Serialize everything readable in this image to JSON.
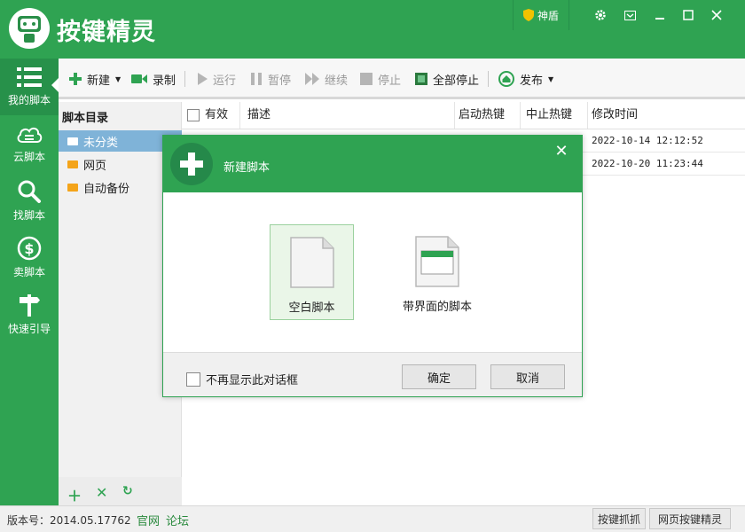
{
  "app": {
    "title": "按键精灵",
    "shield_label": "神盾"
  },
  "leftnav": [
    {
      "label": "我的脚本",
      "icon": "list-icon"
    },
    {
      "label": "云脚本",
      "icon": "cloud-icon"
    },
    {
      "label": "找脚本",
      "icon": "search-icon"
    },
    {
      "label": "卖脚本",
      "icon": "dollar-icon"
    },
    {
      "label": "快速引导",
      "icon": "signpost-icon"
    }
  ],
  "toolbar": {
    "new_label": "新建",
    "record_label": "录制",
    "run_label": "运行",
    "pause_label": "暂停",
    "resume_label": "继续",
    "stop_label": "停止",
    "stop_all_label": "全部停止",
    "publish_label": "发布"
  },
  "directory": {
    "title": "脚本目录",
    "items": [
      "未分类",
      "网页",
      "自动备份"
    ]
  },
  "table": {
    "columns": [
      "有效",
      "描述",
      "启动热键",
      "中止热键",
      "修改时间"
    ],
    "rows": [
      {
        "modified": "2022-10-14 12:12:52"
      },
      {
        "modified": "2022-10-20 11:23:44"
      }
    ]
  },
  "status": {
    "version": "版本号：2014.05.17762",
    "link_official": "官网",
    "link_forum": "论坛",
    "btn_capture": "按键抓抓",
    "btn_web": "网页按键精灵"
  },
  "dialog": {
    "title": "新建脚本",
    "option_blank": "空白脚本",
    "option_ui": "带界面的脚本",
    "dont_show": "不再显示此对话框",
    "ok": "确定",
    "cancel": "取消"
  },
  "colors": {
    "brand": "#2fa352",
    "brand_dark": "#27914a",
    "folder": "#f4a41a"
  }
}
